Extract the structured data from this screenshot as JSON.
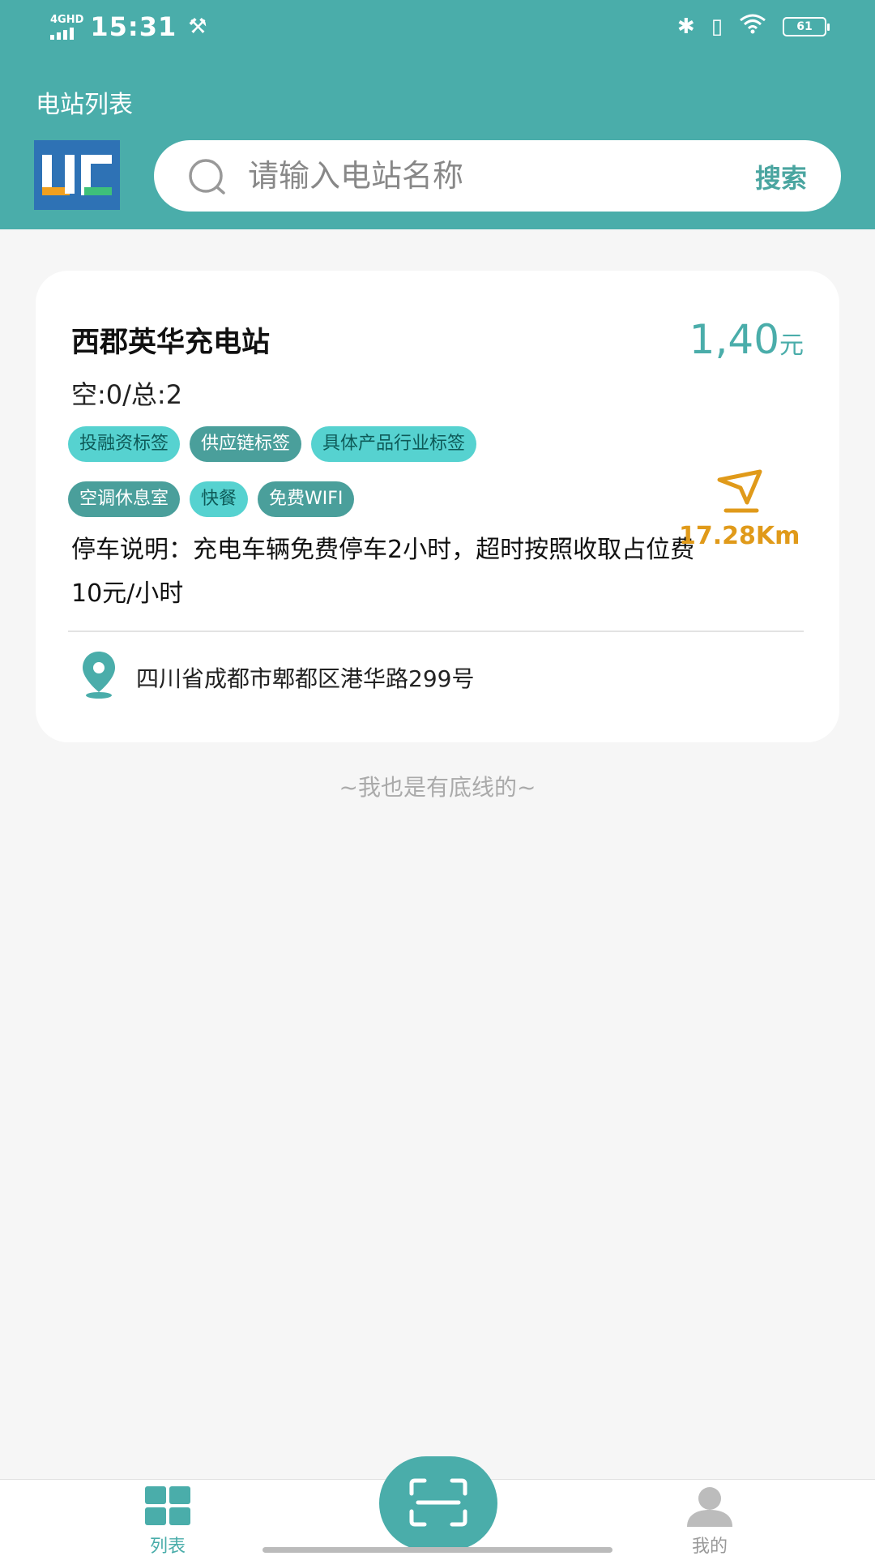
{
  "status_bar": {
    "network": "4GHD",
    "time": "15:31",
    "battery": "61"
  },
  "header": {
    "title": "电站列表"
  },
  "search": {
    "placeholder": "请输入电站名称",
    "button_label": "搜索"
  },
  "station": {
    "name": "西郡英华充电站",
    "price": "1,40",
    "price_unit": "元",
    "availability": "空:0/总:2",
    "tags_row1": [
      {
        "label": "投融资标签",
        "style": "light"
      },
      {
        "label": "供应链标签",
        "style": "dark"
      },
      {
        "label": "具体产品行业标签",
        "style": "light"
      }
    ],
    "tags_row2": [
      {
        "label": "空调休息室",
        "style": "dark"
      },
      {
        "label": "快餐",
        "style": "light"
      },
      {
        "label": "免费WIFI",
        "style": "dark"
      }
    ],
    "parking_note": "停车说明：充电车辆免费停车2小时，超时按照收取占位费10元/小时",
    "distance": "17.28Km",
    "address": "四川省成都市郫都区港华路299号"
  },
  "list_footer": "~我也是有底线的~",
  "tabbar": {
    "list_label": "列表",
    "mine_label": "我的"
  },
  "colors": {
    "primary": "#4aadaa",
    "distance": "#e09a1a",
    "logo_bg": "#2e72b5"
  },
  "icons": {
    "search": "search-icon",
    "navigate": "navigate-icon",
    "location": "location-pin-icon",
    "scan": "scan-icon",
    "list_tab": "grid-icon",
    "mine_tab": "user-icon"
  }
}
